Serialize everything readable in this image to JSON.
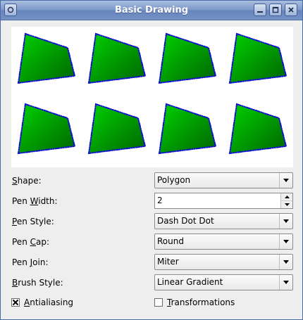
{
  "window": {
    "title": "Basic Drawing"
  },
  "titlebar": {
    "menu_icon": "window-menu-icon",
    "minimize_icon": "minimize-icon",
    "maximize_icon": "maximize-icon",
    "close_icon": "close-icon"
  },
  "render_area": {
    "shape": "polygon",
    "fill_colors": {
      "gradient_start": "#00d200",
      "gradient_end": "#006400"
    },
    "pen_color": "#1010d0",
    "cells": 8
  },
  "controls": {
    "shape": {
      "label_ul": "S",
      "label_rest": "hape:",
      "value": "Polygon"
    },
    "pen_width": {
      "label_pre": "Pen ",
      "label_ul": "W",
      "label_rest": "idth:",
      "value": "2"
    },
    "pen_style": {
      "label_ul": "P",
      "label_rest": "en Style:",
      "value": "Dash Dot Dot"
    },
    "pen_cap": {
      "label_pre": "Pen ",
      "label_ul": "C",
      "label_rest": "ap:",
      "value": "Round"
    },
    "pen_join": {
      "label_pre": "Pen ",
      "label_ul": "J",
      "label_rest": "oin:",
      "value": "Miter"
    },
    "brush_style": {
      "label_ul": "B",
      "label_rest": "rush Style:",
      "value": "Linear Gradient"
    }
  },
  "options": {
    "antialiasing": {
      "label_ul": "A",
      "label_rest": "ntialiasing",
      "checked": true
    },
    "transformations": {
      "label_ul": "T",
      "label_rest": "ransformations",
      "checked": false
    }
  }
}
